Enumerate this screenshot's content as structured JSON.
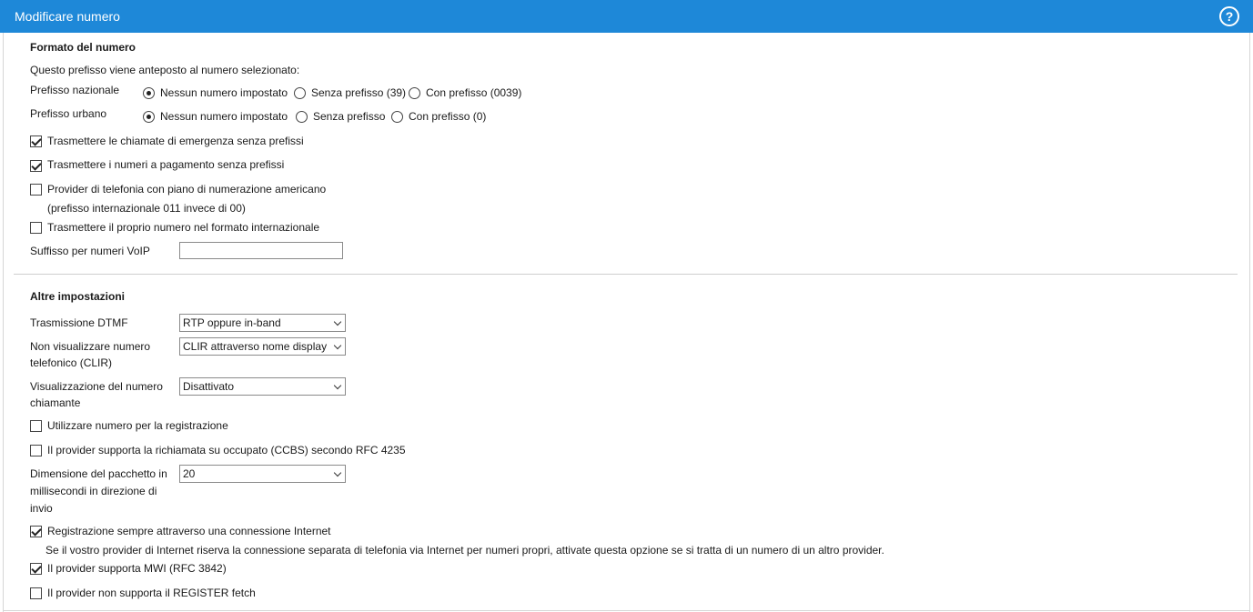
{
  "dialog": {
    "title": "Modificare numero",
    "help_icon": "help-icon",
    "help_symbol": "?"
  },
  "number_format": {
    "heading": "Formato del numero",
    "intro": "Questo prefisso viene anteposto al numero selezionato:",
    "national": {
      "label": "Prefisso nazionale",
      "options": [
        "Nessun numero impostato",
        "Senza prefisso (39)",
        "Con prefisso (0039)"
      ],
      "selected": "Nessun numero impostato"
    },
    "urban": {
      "label": "Prefisso urbano",
      "options": [
        "Nessun numero impostato",
        "Senza prefisso",
        "Con prefisso (0)"
      ],
      "selected": "Nessun numero impostato"
    },
    "emergency": {
      "label": "Trasmettere le chiamate di emergenza senza prefissi",
      "checked": true
    },
    "premium": {
      "label": "Trasmettere i numeri a pagamento senza prefissi",
      "checked": true
    },
    "american": {
      "label": "Provider di telefonia con piano di numerazione americano",
      "note": "(prefisso internazionale 011 invece di 00)",
      "checked": false
    },
    "international": {
      "label": "Trasmettere il proprio numero nel formato internazionale",
      "checked": false
    },
    "voip_suffix": {
      "label": "Suffisso per numeri VoIP",
      "value": ""
    }
  },
  "other_settings": {
    "heading": "Altre impostazioni",
    "dtmf": {
      "label": "Trasmissione DTMF",
      "value": "RTP oppure in-band"
    },
    "clir": {
      "label_line1": "Non visualizzare numero",
      "label_line2": "telefonico (CLIR)",
      "value": "CLIR attraverso nome display"
    },
    "caller_display": {
      "label_line1": "Visualizzazione del numero",
      "label_line2": "chiamante",
      "value": "Disattivato"
    },
    "use_for_registration": {
      "label": "Utilizzare numero per la registrazione",
      "checked": false
    },
    "ccbs": {
      "label": "Il provider supporta la richiamata su occupato (CCBS) secondo RFC 4235",
      "checked": false
    },
    "packet_size": {
      "label_line1": "Dimensione del pacchetto in",
      "label_line2": "millisecondi in direzione di",
      "label_line3": "invio",
      "value": "20"
    },
    "always_internet": {
      "label": "Registrazione sempre attraverso una connessione Internet",
      "note": "Se il vostro provider di Internet riserva la connessione separata di telefonia via Internet per numeri propri, attivate questa opzione se si tratta di un numero di un altro provider.",
      "checked": true
    },
    "mwi": {
      "label": "Il provider supporta MWI (RFC 3842)",
      "checked": true
    },
    "register_fetch": {
      "label": "Il provider non supporta il REGISTER fetch",
      "checked": false
    }
  }
}
